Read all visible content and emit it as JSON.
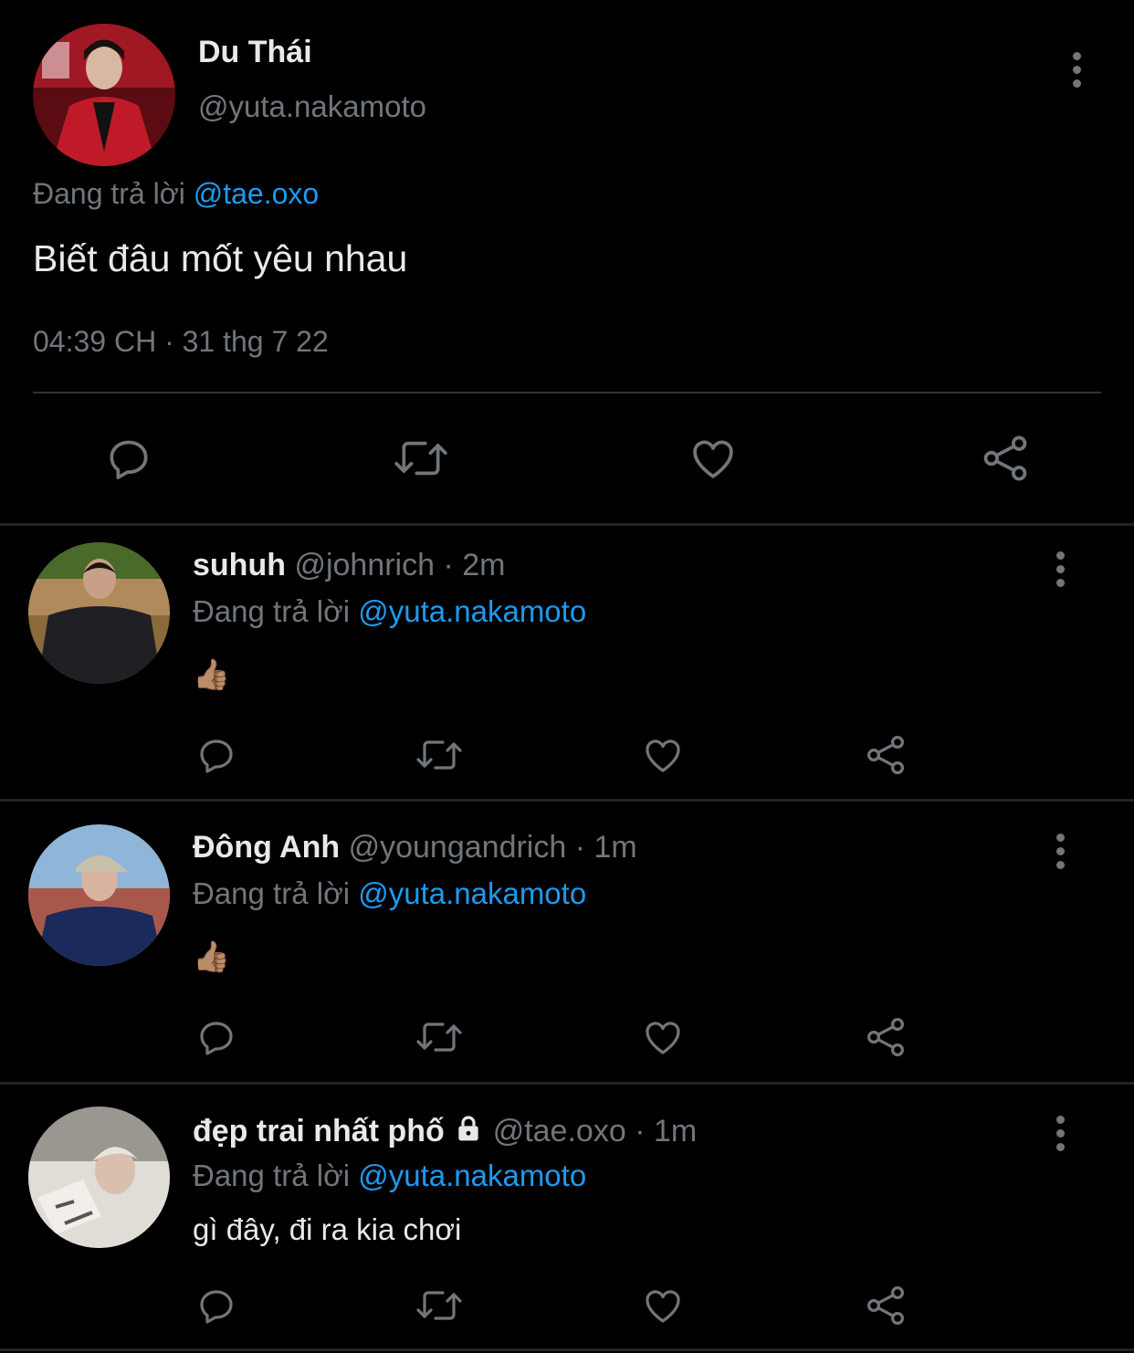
{
  "main_tweet": {
    "name": "Du Thái",
    "handle": "@yuta.nakamoto",
    "replying_label": "Đang trả lời",
    "replying_to": "@tae.oxo",
    "text": "Biết đâu mốt yêu nhau",
    "timestamp": "04:39 CH · 31 thg 7 22"
  },
  "replies": [
    {
      "name": "suhuh",
      "handle": "@johnrich",
      "sep": "·",
      "time": "2m",
      "replying_label": "Đang trả lời",
      "replying_to": "@yuta.nakamoto",
      "text": "👍🏽"
    },
    {
      "name": "Đông Anh",
      "handle": "@youngandrich",
      "sep": "·",
      "time": "1m",
      "replying_label": "Đang trả lời",
      "replying_to": "@yuta.nakamoto",
      "text": "👍🏽"
    },
    {
      "name": "đẹp trai nhất phố",
      "handle": "@tae.oxo",
      "sep": "·",
      "time": "1m",
      "replying_label": "Đang trả lời",
      "replying_to": "@yuta.nakamoto",
      "text": "gì đây, đi ra kia chơi",
      "locked": true
    }
  ],
  "icons": [
    "comment-icon",
    "retweet-icon",
    "like-icon",
    "share-icon",
    "more-icon",
    "lock-icon"
  ],
  "colors": {
    "background": "#000000",
    "text": "#e7e9ea",
    "muted": "#71767b",
    "link": "#1d9bf0",
    "divider": "#202327"
  }
}
